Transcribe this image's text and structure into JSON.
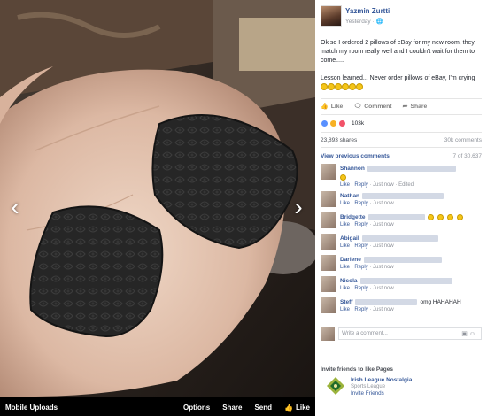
{
  "viewer": {
    "album_label": "Mobile Uploads",
    "prev_icon": "chevron-left-icon",
    "next_icon": "chevron-right-icon",
    "options_label": "Options",
    "share_label": "Share",
    "send_label": "Send",
    "like_label": "Like"
  },
  "post": {
    "author": "Yazmin Zurtti",
    "time": "Yesterday · ",
    "text_p1": "Ok so I ordered 2 pillows of eBay for my new room, they match my room really well and I couldn't wait for them to come.....",
    "text_p2": "Lesson learned... Never order pillows of eBay, I'm crying",
    "actions": {
      "like": "Like",
      "comment": "Comment",
      "share": "Share"
    },
    "reaction_count": "103k",
    "shares": "23,893 shares",
    "comments_count": "30k comments",
    "view_previous": "View previous comments",
    "pagination": "7 of 30,637"
  },
  "comments": [
    {
      "name": "Shannon",
      "text": "",
      "meta_extra": " · Edited"
    },
    {
      "name": "Nathan",
      "text": "",
      "meta_extra": ""
    },
    {
      "name": "Bridgette",
      "text": "",
      "meta_extra": ""
    },
    {
      "name": "Abigail",
      "text": "",
      "meta_extra": ""
    },
    {
      "name": "Darlene",
      "text": "",
      "meta_extra": ""
    },
    {
      "name": "Nicola",
      "text": "",
      "meta_extra": ""
    },
    {
      "name": "Steff",
      "text": "omg HAHAHAH",
      "meta_extra": ""
    }
  ],
  "comment_meta": {
    "like": "Like",
    "reply": "Reply",
    "time": "Just now"
  },
  "composer": {
    "placeholder": "Write a comment...",
    "camera_icon": "camera-icon",
    "emoji_icon": "emoji-icon"
  },
  "invite": {
    "title": "Invite friends to like Pages",
    "page_name": "Irish League Nostalgia",
    "page_category": "Sports League",
    "invite_link": "Invite Friends"
  },
  "colors": {
    "link": "#365899",
    "muted": "#90949c",
    "accent": "#4267b2"
  }
}
